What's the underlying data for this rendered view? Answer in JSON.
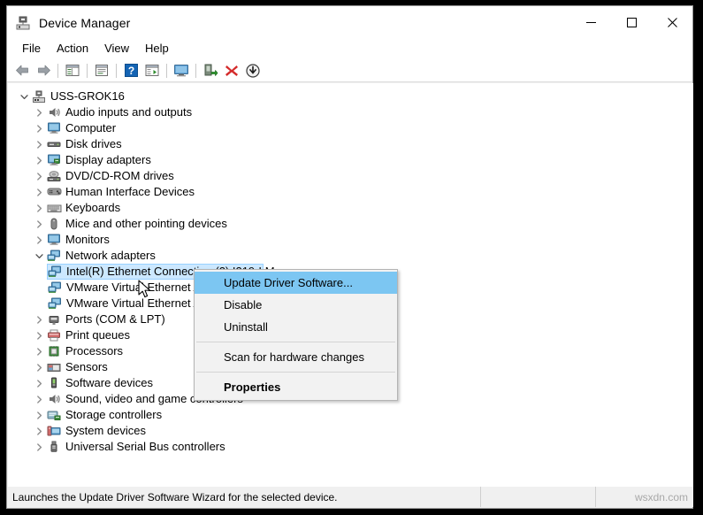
{
  "window": {
    "title": "Device Manager",
    "icon": "device-manager-icon",
    "caption": {
      "minimize": "—",
      "maximize": "☐",
      "close": "✕"
    }
  },
  "menubar": {
    "items": [
      {
        "label": "File"
      },
      {
        "label": "Action"
      },
      {
        "label": "View"
      },
      {
        "label": "Help"
      }
    ]
  },
  "toolbar": {
    "buttons": [
      {
        "name": "back-icon",
        "tip": "Back"
      },
      {
        "name": "forward-icon",
        "tip": "Forward"
      },
      {
        "name": "show-hide-console-tree-icon",
        "tip": "Show/Hide Console Tree"
      },
      {
        "name": "properties-icon",
        "tip": "Properties"
      },
      {
        "name": "help-icon",
        "tip": "Help"
      },
      {
        "name": "scan-for-hardware-changes-icon",
        "tip": "Scan for hardware changes"
      },
      {
        "name": "display-icon",
        "tip": "Display"
      },
      {
        "name": "enable-device-icon",
        "tip": "Enable device"
      },
      {
        "name": "uninstall-device-icon",
        "tip": "Uninstall device"
      },
      {
        "name": "update-driver-icon",
        "tip": "Update driver"
      }
    ]
  },
  "tree": {
    "root": {
      "label": "USS-GROK16",
      "icon": "computer-root-icon",
      "expanded": true
    },
    "items": [
      {
        "label": "Audio inputs and outputs",
        "icon": "speaker-icon",
        "level": 1,
        "expanded": false
      },
      {
        "label": "Computer",
        "icon": "monitor-icon",
        "level": 1,
        "expanded": false
      },
      {
        "label": "Disk drives",
        "icon": "disk-icon",
        "level": 1,
        "expanded": false
      },
      {
        "label": "Display adapters",
        "icon": "display-adapter-icon",
        "level": 1,
        "expanded": false
      },
      {
        "label": "DVD/CD-ROM drives",
        "icon": "optical-drive-icon",
        "level": 1,
        "expanded": false
      },
      {
        "label": "Human Interface Devices",
        "icon": "hid-icon",
        "level": 1,
        "expanded": false
      },
      {
        "label": "Keyboards",
        "icon": "keyboard-icon",
        "level": 1,
        "expanded": false
      },
      {
        "label": "Mice and other pointing devices",
        "icon": "mouse-icon",
        "level": 1,
        "expanded": false
      },
      {
        "label": "Monitors",
        "icon": "monitor-icon",
        "level": 1,
        "expanded": false
      },
      {
        "label": "Network adapters",
        "icon": "network-adapter-icon",
        "level": 1,
        "expanded": true
      },
      {
        "label": "Intel(R) Ethernet Connection (2) I219-LM",
        "icon": "network-adapter-icon",
        "level": 2,
        "selected": true
      },
      {
        "label": "VMware Virtual Ethernet Adapter for VMnet1",
        "icon": "network-adapter-icon",
        "level": 2
      },
      {
        "label": "VMware Virtual Ethernet Adapter for VMnet8",
        "icon": "network-adapter-icon",
        "level": 2
      },
      {
        "label": "Ports (COM & LPT)",
        "icon": "port-icon",
        "level": 1,
        "expanded": false
      },
      {
        "label": "Print queues",
        "icon": "printer-icon",
        "level": 1,
        "expanded": false
      },
      {
        "label": "Processors",
        "icon": "processor-icon",
        "level": 1,
        "expanded": false
      },
      {
        "label": "Sensors",
        "icon": "sensor-icon",
        "level": 1,
        "expanded": false
      },
      {
        "label": "Software devices",
        "icon": "software-device-icon",
        "level": 1,
        "expanded": false
      },
      {
        "label": "Sound, video and game controllers",
        "icon": "speaker-icon",
        "level": 1,
        "expanded": false
      },
      {
        "label": "Storage controllers",
        "icon": "storage-controller-icon",
        "level": 1,
        "expanded": false
      },
      {
        "label": "System devices",
        "icon": "system-device-icon",
        "level": 1,
        "expanded": false
      },
      {
        "label": "Universal Serial Bus controllers",
        "icon": "usb-icon",
        "level": 1,
        "expanded": false
      }
    ]
  },
  "context_menu": {
    "items": [
      {
        "label": "Update Driver Software...",
        "selected": true,
        "bold": false
      },
      {
        "label": "Disable",
        "selected": false,
        "bold": false
      },
      {
        "label": "Uninstall",
        "selected": false,
        "bold": false
      },
      {
        "separator": true
      },
      {
        "label": "Scan for hardware changes",
        "selected": false,
        "bold": false
      },
      {
        "separator": true
      },
      {
        "label": "Properties",
        "selected": false,
        "bold": true
      }
    ]
  },
  "statusbar": {
    "message": "Launches the Update Driver Software Wizard for the selected device.",
    "middle": "",
    "watermark": "wsxdn.com"
  },
  "colors": {
    "selection_fill": "#cce8ff",
    "selection_border": "#99d1ff",
    "menu_highlight": "#7cc6f2",
    "menu_background": "#f2f2f2",
    "window_background": "#f0f0f0",
    "panel_background": "#ffffff"
  }
}
